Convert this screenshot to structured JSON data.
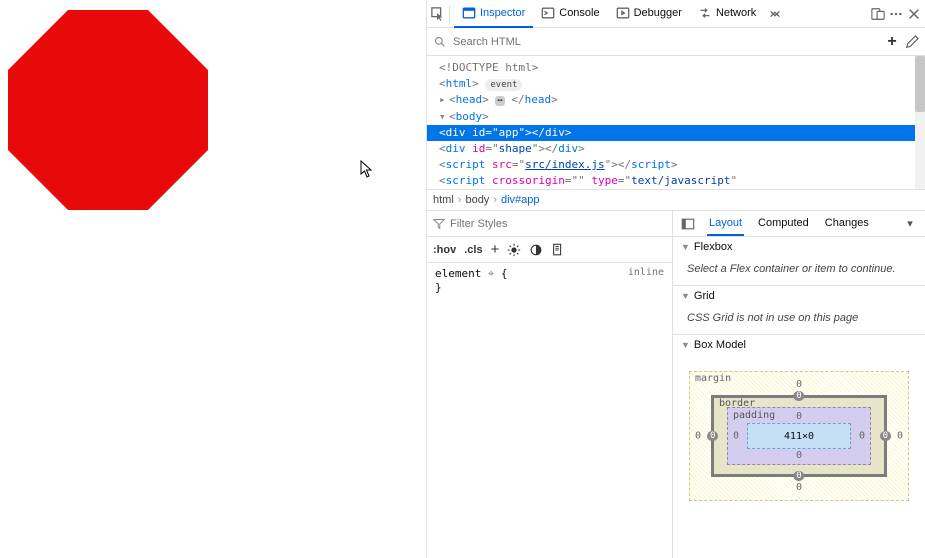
{
  "toolbar": {
    "inspector": "Inspector",
    "console": "Console",
    "debugger": "Debugger",
    "network": "Network"
  },
  "search": {
    "placeholder": "Search HTML"
  },
  "dom": {
    "doctype": "<!DOCTYPE html>",
    "html_tag": "html",
    "event_pill": "event",
    "head_tag": "head",
    "body_tag": "body",
    "div_tag": "div",
    "id_attr": "id",
    "app_val": "app",
    "shape_val": "shape",
    "script_tag": "script",
    "src_attr": "src",
    "src_val": "src/index.js",
    "crossorigin_attr": "crossorigin",
    "crossorigin_val": "",
    "type_attr": "type",
    "type_val": "text/javascript"
  },
  "breadcrumb": {
    "a": "html",
    "b": "body",
    "c": "div#app"
  },
  "filter": {
    "placeholder": "Filter Styles"
  },
  "stylebar": {
    "hov": ":hov",
    "cls": ".cls"
  },
  "rules": {
    "element": "element",
    "brace_open": "{",
    "brace_close": "}",
    "inline": "inline"
  },
  "sidetabs": {
    "layout": "Layout",
    "computed": "Computed",
    "changes": "Changes"
  },
  "flexbox": {
    "title": "Flexbox",
    "msg": "Select a Flex container or item to continue."
  },
  "grid": {
    "title": "Grid",
    "msg": "CSS Grid is not in use on this page"
  },
  "boxmodel": {
    "title": "Box Model",
    "margin": "margin",
    "border": "border",
    "padding": "padding",
    "content": "411×0",
    "zero": "0"
  }
}
